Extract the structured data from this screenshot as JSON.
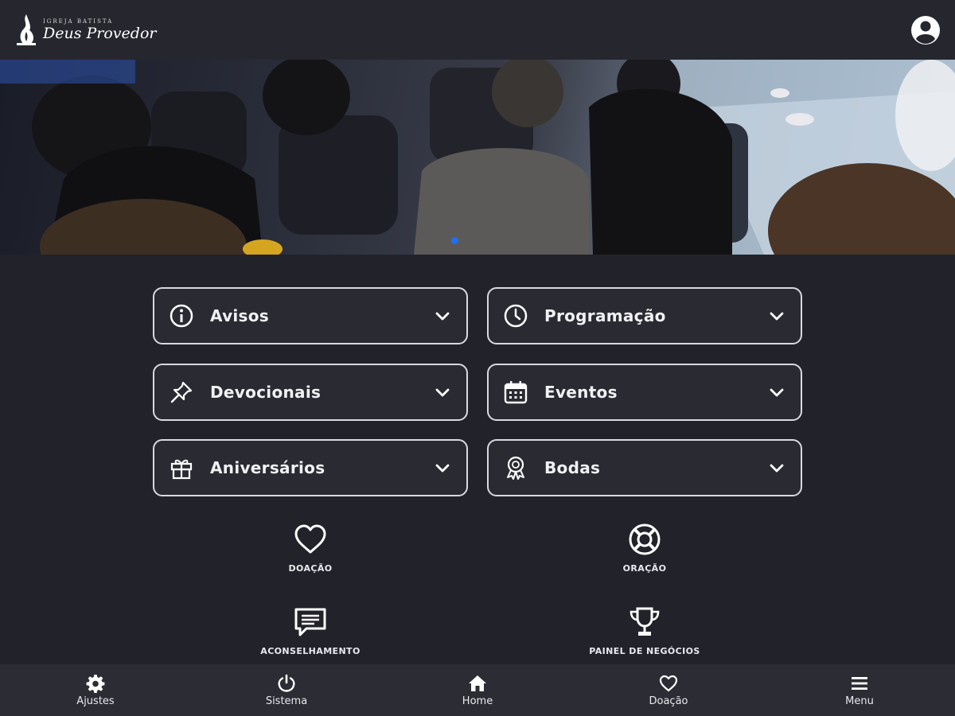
{
  "header": {
    "logo_small": "Igreja Batista",
    "logo_big": "Deus Provedor"
  },
  "cards": [
    {
      "label": "Avisos",
      "icon": "info-icon"
    },
    {
      "label": "Programação",
      "icon": "clock-icon"
    },
    {
      "label": "Devocionais",
      "icon": "pin-icon"
    },
    {
      "label": "Eventos",
      "icon": "calendar-icon"
    },
    {
      "label": "Aniversários",
      "icon": "gift-icon"
    },
    {
      "label": "Bodas",
      "icon": "award-icon"
    }
  ],
  "quick_actions": [
    {
      "label": "DOAÇÃO",
      "icon": "heart-icon"
    },
    {
      "label": "ORAÇÃO",
      "icon": "lifebuoy-icon"
    },
    {
      "label": "ACONSELHAMENTO",
      "icon": "message-icon"
    },
    {
      "label": "PAINEL DE NEGÓCIOS",
      "icon": "trophy-icon"
    }
  ],
  "bottom_nav": [
    {
      "label": "Ajustes",
      "icon": "gear-icon"
    },
    {
      "label": "Sistema",
      "icon": "power-icon"
    },
    {
      "label": "Home",
      "icon": "home-icon"
    },
    {
      "label": "Doação",
      "icon": "heart-icon"
    },
    {
      "label": "Menu",
      "icon": "menu-icon"
    }
  ],
  "colors": {
    "background": "#22232a",
    "header": "#26272e",
    "card_border": "#d9d9e0",
    "accent_dot": "#1f6ff0"
  }
}
